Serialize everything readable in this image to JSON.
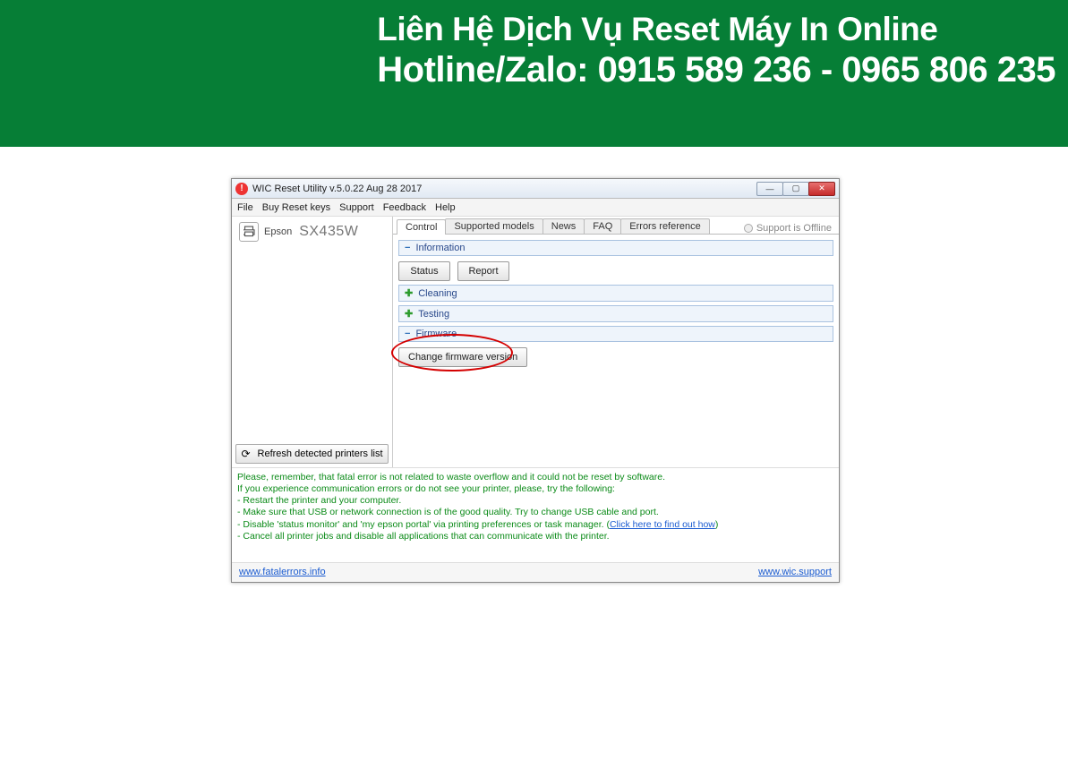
{
  "banner": {
    "line1": "Liên Hệ Dịch Vụ Reset Máy In Online",
    "line2": "Hotline/Zalo: 0915 589 236 - 0965 806 235"
  },
  "window": {
    "title": "WIC Reset Utility v.5.0.22 Aug 28 2017"
  },
  "menu": {
    "file": "File",
    "buy_reset_keys": "Buy Reset keys",
    "support": "Support",
    "feedback": "Feedback",
    "help": "Help"
  },
  "sidebar": {
    "printer_brand": "Epson",
    "printer_model": "SX435W",
    "refresh_label": "Refresh detected printers list"
  },
  "tabs": {
    "control": "Control",
    "supported_models": "Supported models",
    "news": "News",
    "faq": "FAQ",
    "errors_reference": "Errors reference"
  },
  "support_status": "Support is Offline",
  "sections": {
    "information": {
      "title": "Information",
      "status_btn": "Status",
      "report_btn": "Report"
    },
    "cleaning": {
      "title": "Cleaning"
    },
    "testing": {
      "title": "Testing"
    },
    "firmware": {
      "title": "Firmware",
      "change_btn": "Change firmware version"
    }
  },
  "help_lines": {
    "l1": "Please, remember, that fatal error is not related to waste overflow and it could not be reset by software.",
    "l2": "If you experience communication errors or do not see your printer, please, try the following:",
    "l3": "- Restart the printer and your computer.",
    "l4": "- Make sure that USB or network connection is of the good quality. Try to change USB cable and port.",
    "l5a": "- Disable 'status monitor' and 'my epson portal' via printing preferences or task manager. (",
    "l5link": "Click here to find out how",
    "l5b": ")",
    "l6": "- Cancel all printer jobs and disable all applications that can communicate with the printer."
  },
  "footer": {
    "left_link": "www.fatalerrors.info",
    "right_link": "www.wic.support"
  }
}
